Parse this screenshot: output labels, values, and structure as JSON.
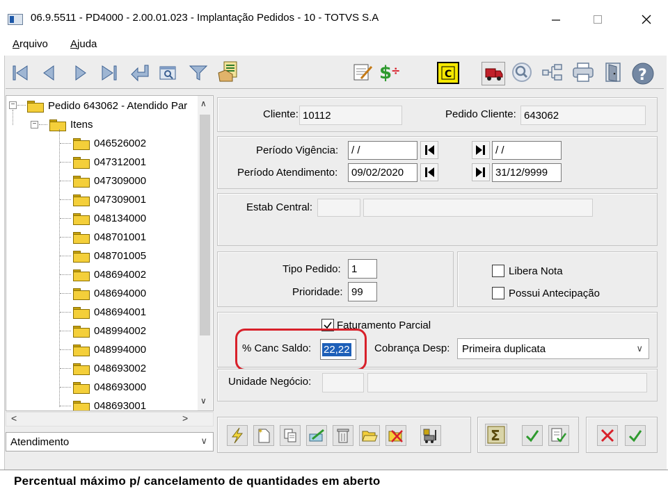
{
  "window": {
    "title": "06.9.5511 - PD4000 - 2.00.01.023 - Implantação Pedidos - 10 - TOTVS S.A"
  },
  "menu": {
    "items": [
      {
        "label": "Arquivo",
        "accel": "A",
        "rest": "rquivo"
      },
      {
        "label": "Ajuda",
        "accel": "A",
        "rest": "juda"
      }
    ]
  },
  "tree": {
    "root": "Pedido 643062 - Atendido Par",
    "group": "Itens",
    "items": [
      "046526002",
      "047312001",
      "047309000",
      "047309001",
      "048134000",
      "048701001",
      "048701005",
      "048694002",
      "048694000",
      "048694001",
      "048994002",
      "048994000",
      "048693002",
      "048693000",
      "048693001"
    ]
  },
  "view_selector": {
    "selected": "Atendimento"
  },
  "header": {
    "cliente_label": "Cliente:",
    "cliente_value": "10112",
    "pedido_cliente_label": "Pedido Cliente:",
    "pedido_cliente_value": "643062"
  },
  "periodo": {
    "vigencia_label": "Período Vigência:",
    "vigencia_start": " / /",
    "vigencia_end": " / /",
    "atendimento_label": "Período Atendimento:",
    "atendimento_start": "09/02/2020",
    "atendimento_end": "31/12/9999"
  },
  "estab": {
    "label": "Estab Central:",
    "code": "",
    "desc": ""
  },
  "tipo": {
    "tipo_label": "Tipo Pedido:",
    "tipo_value": "1",
    "prioridade_label": "Prioridade:",
    "prioridade_value": "99"
  },
  "flags": {
    "libera_nota": "Libera Nota",
    "possui_antecipacao": "Possui Antecipação",
    "libera_nota_checked": false,
    "possui_antecipacao_checked": false
  },
  "faturamento": {
    "parcial_label": "Faturamento Parcial",
    "parcial_checked": true,
    "canc_saldo_label": "% Canc Saldo:",
    "canc_saldo_value": "22,22",
    "cobranca_label": "Cobrança Desp:",
    "cobranca_value": "Primeira duplicata"
  },
  "unidade": {
    "label": "Unidade Negócio:",
    "code": "",
    "desc": ""
  },
  "status": {
    "text": "Percentual máximo p/ cancelamento de quantidades em aberto"
  },
  "colors": {
    "accent_blue": "#1d5fb8",
    "highlight_red": "#d8202a",
    "status_green": "#2e9a2e"
  }
}
